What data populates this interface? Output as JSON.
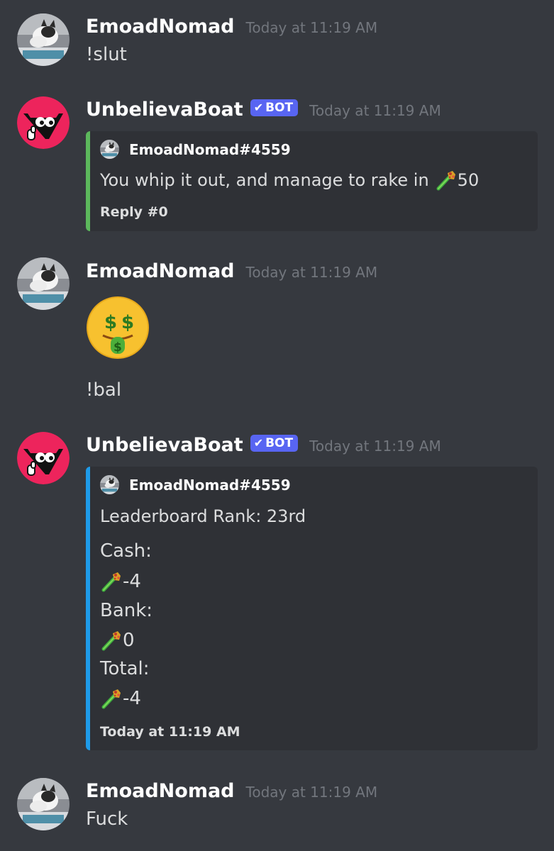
{
  "messages": [
    {
      "username": "EmoadNomad",
      "timestamp": "Today at 11:19 AM",
      "text": "!slut",
      "avatar_icon": "cat-avatar-icon"
    },
    {
      "username": "UnbelievaBoat",
      "bot_tag": "BOT",
      "timestamp": "Today at 11:19 AM",
      "avatar_icon": "unbelievaboat-avatar-icon",
      "embed": {
        "accent_color": "#5cb85c",
        "author": "EmoadNomad#4559",
        "description_text": "You whip it out, and manage to rake in",
        "amount": "50",
        "currency_icon": "currency-wand-icon",
        "footer": "Reply #0"
      }
    },
    {
      "username": "EmoadNomad",
      "timestamp": "Today at 11:19 AM",
      "avatar_icon": "cat-avatar-icon",
      "emoji_icon": "money-mouth-face-icon",
      "text": "!bal"
    },
    {
      "username": "UnbelievaBoat",
      "bot_tag": "BOT",
      "timestamp": "Today at 11:19 AM",
      "avatar_icon": "unbelievaboat-avatar-icon",
      "embed": {
        "accent_color": "#1e9be9",
        "author": "EmoadNomad#4559",
        "rank": "Leaderboard Rank: 23rd",
        "cash_label": "Cash:",
        "cash_value": "-4",
        "bank_label": "Bank:",
        "bank_value": "0",
        "total_label": "Total:",
        "total_value": "-4",
        "currency_icon": "currency-wand-icon",
        "footer": "Today at 11:19 AM"
      }
    },
    {
      "username": "EmoadNomad",
      "timestamp": "Today at 11:19 AM",
      "text": "Fuck",
      "avatar_icon": "cat-avatar-icon"
    }
  ],
  "colors": {
    "background": "#36393f",
    "embed_background": "#2f3136",
    "bot_tag": "#5865f2",
    "bot_avatar": "#ed245c"
  }
}
